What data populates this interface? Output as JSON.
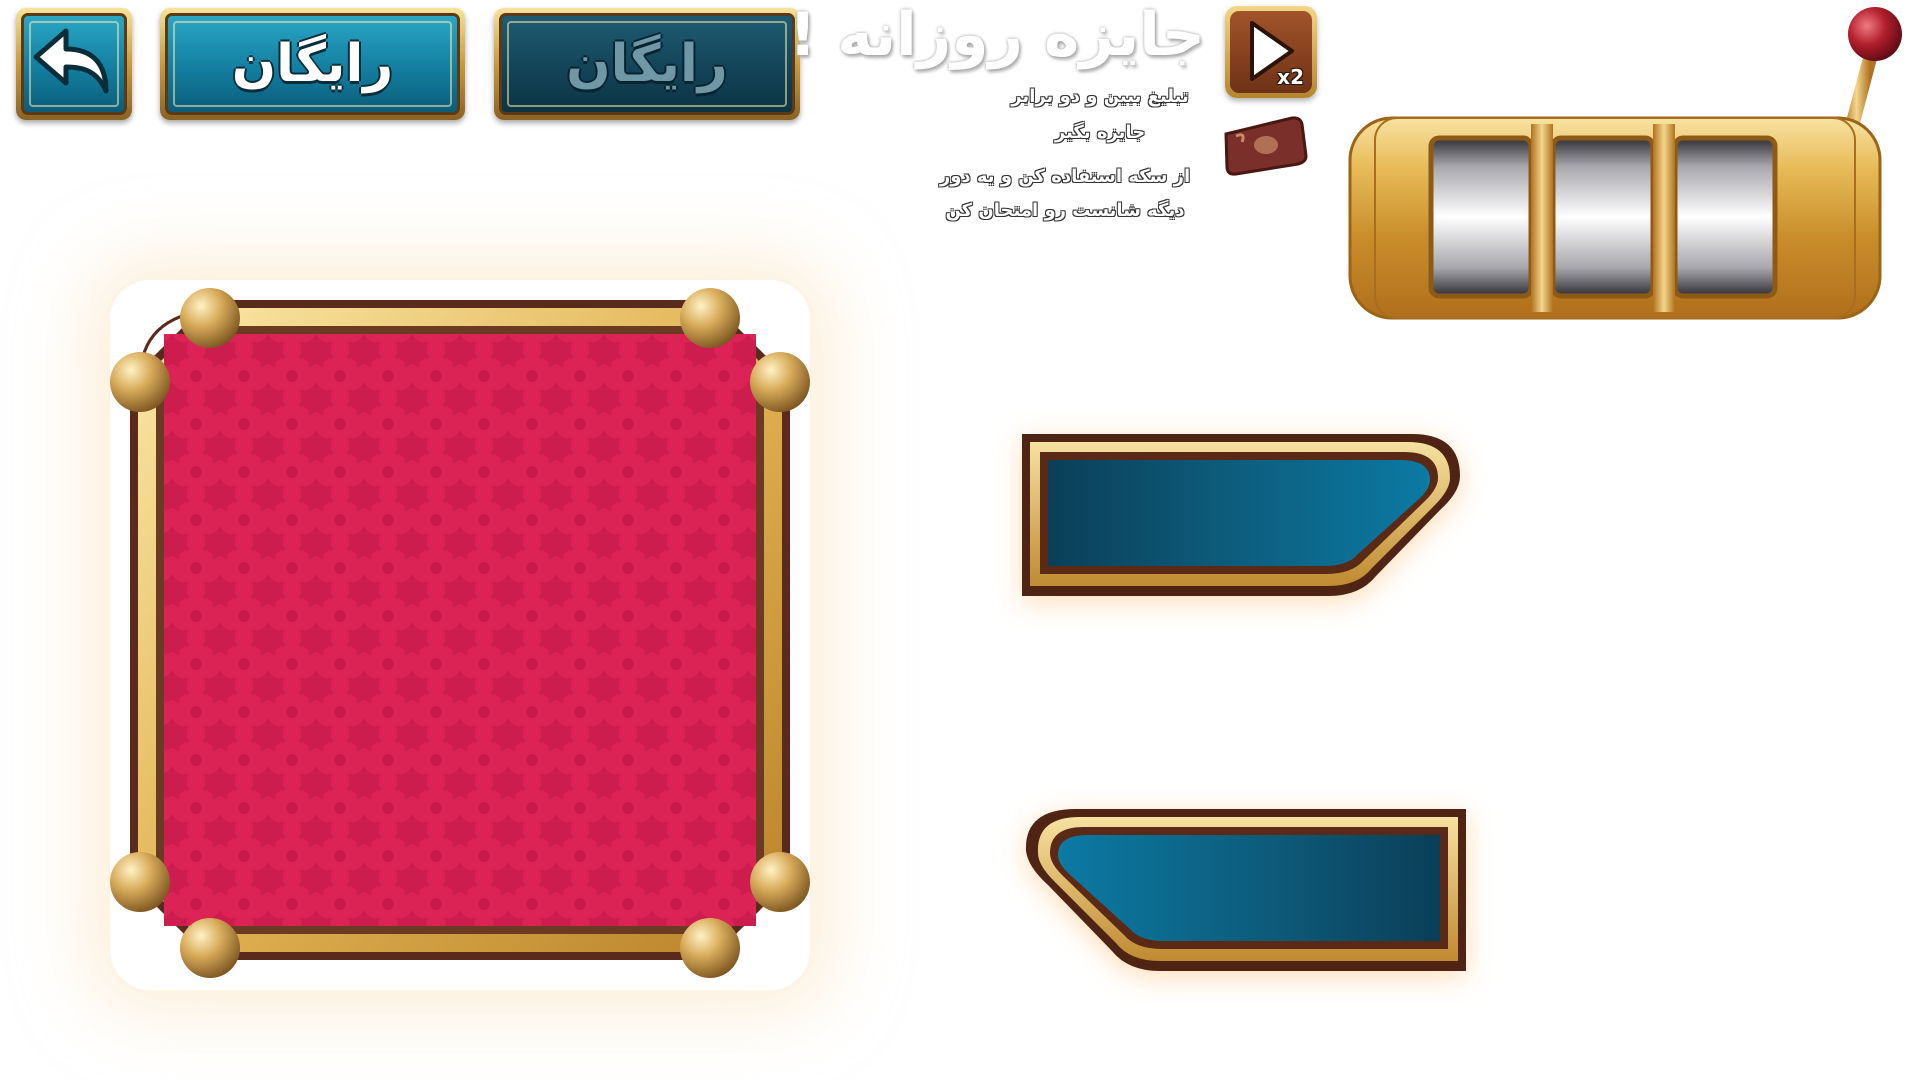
{
  "header": {
    "back_icon": "back-arrow-icon",
    "free_button_active": "رایگان",
    "free_button_inactive": "رایگان",
    "title": "جایزه روزانه !",
    "video_button": {
      "icon": "play-video-icon",
      "multiplier": "x2"
    },
    "info_line_1": "تبلیغ ببین و دو برابر",
    "info_line_2": "جایزه بگیر",
    "info_line_3": "از سکه استفاده کن و یه دور",
    "info_line_4": "دیگه شانست رو امتحان کن",
    "cash_icon": "cash-note-icon"
  },
  "colors": {
    "teal": "#137ea0",
    "dark_teal": "#134457",
    "gold": "#d9ab4b",
    "red_panel": "#d81e52",
    "frame_brown": "#5a2b1c"
  }
}
